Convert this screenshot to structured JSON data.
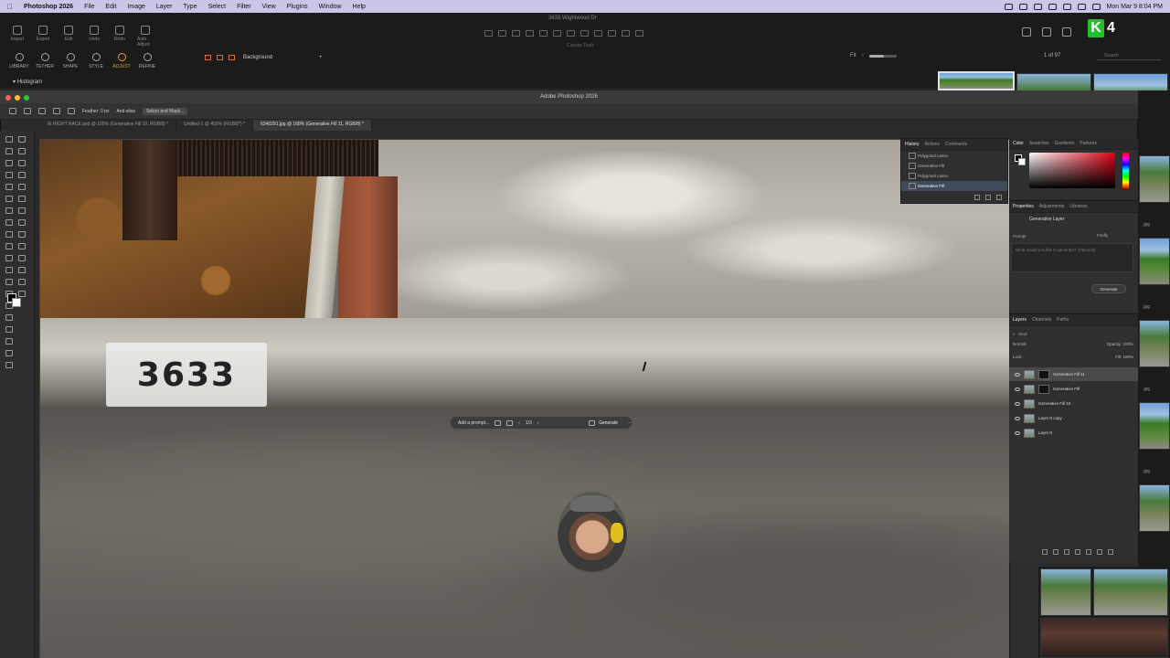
{
  "menubar": {
    "app": "Photoshop 2026",
    "items": [
      "File",
      "Edit",
      "Image",
      "Layer",
      "Type",
      "Select",
      "Filter",
      "View",
      "Plugins",
      "Window",
      "Help"
    ],
    "clock": "Mon Mar 9  8:04 PM"
  },
  "lr": {
    "doc_title": "3633 Wightwood Dr",
    "tools": [
      "Import",
      "Export",
      "Edit",
      "Undo",
      "Redo",
      "Auto Adjust"
    ],
    "modes": [
      "LIBRARY",
      "TETHER",
      "SHAPE",
      "STYLE",
      "ADJUST",
      "REFINE"
    ],
    "active_mode": "ADJUST",
    "histogram": "Histogram",
    "layer_select": "Background",
    "center_label": "Canvas Tools",
    "count": "1 of 97",
    "search_placeholder": "Search"
  },
  "badge": {
    "letter": "K",
    "number": "4"
  },
  "ps": {
    "window_title": "Adobe Photoshop 2026",
    "options": {
      "feather": "Feather:  0 px",
      "antialias": "Anti-alias",
      "select_mask": "Select and Mask..."
    },
    "tabs": [
      "IE RIGHT RACE.psd @ 100% (Generative Fill 10, RGB/8) *",
      "Untitled-1 @ 455% (RGB/8*) *",
      "6340291.jpg @ 168% (Generative Fill 11, RGB/8) *"
    ],
    "curb_number": "3633",
    "gen_bar": {
      "prompt": "Add a prompt...",
      "count": "1/3",
      "generate": "Generate"
    }
  },
  "history": {
    "tabs": [
      "History",
      "Actions",
      "Comments"
    ],
    "items": [
      "Polygonal Lasso",
      "Generative Fill",
      "Polygonal Lasso",
      "Generative Fill"
    ]
  },
  "color": {
    "tabs": [
      "Color",
      "Swatches",
      "Gradients",
      "Patterns"
    ]
  },
  "properties": {
    "tabs": [
      "Properties",
      "Adjustments",
      "Libraries"
    ],
    "title": "Generative Layer",
    "prompt_label": "Prompt",
    "model": "Firefly",
    "placeholder": "What would you like to generate? (Optional)",
    "generate": "Generate"
  },
  "layers": {
    "tabs": [
      "Layers",
      "Channels",
      "Paths"
    ],
    "kind": "Kind",
    "blend": "Normal",
    "opacity": "Opacity: 100%",
    "lock": "Lock:",
    "fill": "Fill: 100%",
    "rows": [
      "Generative Fill 11",
      "Generative Fill",
      "Generative Fill 10",
      "Layer 0 copy",
      "Layer 0"
    ]
  },
  "film_right": {
    "jpg": ".jpg"
  }
}
